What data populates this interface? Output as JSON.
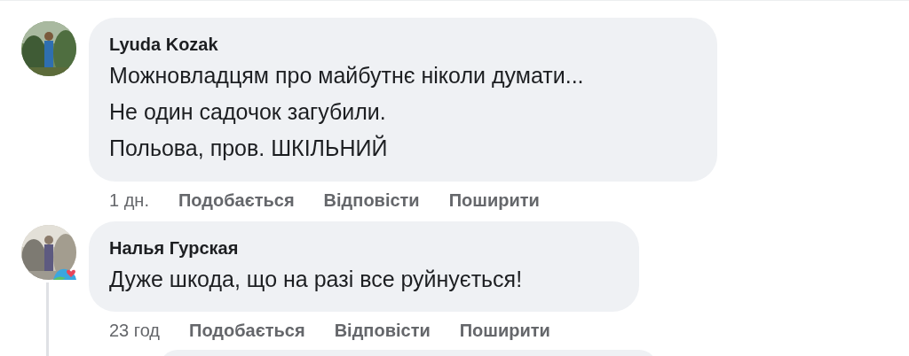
{
  "comments": [
    {
      "author": "Lyuda Kozak",
      "lines": [
        "Можновладцям про майбутнє ніколи думати...",
        "Не один садочок загубили.",
        "Польова, пров. ШКІЛЬНИЙ"
      ],
      "time": "1 дн.",
      "actions": [
        "Подобається",
        "Відповісти",
        "Поширити"
      ],
      "badge": false
    },
    {
      "author": "Налья Гурская",
      "lines": [
        "Дуже шкода, що на разі все руйнується!"
      ],
      "time": "23 год",
      "actions": [
        "Подобається",
        "Відповісти",
        "Поширити"
      ],
      "badge": true
    }
  ]
}
